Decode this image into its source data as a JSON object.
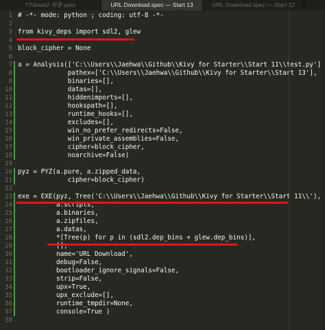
{
  "tabs": [
    {
      "label": "YTdown2 최종 spec",
      "active": false
    },
    {
      "label": "URL Download.spec — Start 13",
      "active": true
    },
    {
      "label": "URL Download.spec — Start 12",
      "active": false
    }
  ],
  "code_lines": [
    "# -*- mode: python ; coding: utf-8 -*-",
    "",
    "from kivy_deps import sdl2, glew",
    "",
    "block_cipher = None",
    "",
    "a = Analysis(['C:\\\\Users\\\\Jaehwa\\\\Github\\\\Kivy for Starter\\\\Start 11\\\\test.py'],",
    "             pathex=['C:\\\\Users\\\\Jaehwa\\\\Github\\\\Kivy for Starter\\\\Start 13'],",
    "             binaries=[],",
    "             datas=[],",
    "             hiddenimports=[],",
    "             hookspath=[],",
    "             runtime_hooks=[],",
    "             excludes=[],",
    "             win_no_prefer_redirects=False,",
    "             win_private_assemblies=False,",
    "             cipher=block_cipher,",
    "             noarchive=False)",
    "",
    "pyz = PYZ(a.pure, a.zipped_data,",
    "             cipher=block_cipher)",
    "",
    "exe = EXE(pyz, Tree('C:\\\\Users\\\\Jaehwa\\\\Github\\\\Kivy for Starter\\\\Start 11\\\\'),",
    "          a.scripts,",
    "          a.binaries,",
    "          a.zipfiles,",
    "          a.datas,",
    "          *[Tree(p) for p in (sdl2.dep_bins + glew.dep_bins)],",
    "          [],",
    "          name='URL Download',",
    "          debug=False,",
    "          bootloader_ignore_signals=False,",
    "          strip=False,",
    "          upx=True,",
    "          upx_exclude=[],",
    "          runtime_tmpdir=None,",
    "          console=True )",
    ""
  ],
  "line_numbers": [
    "1",
    "2",
    "3",
    "4",
    "5",
    "6",
    "7",
    "8",
    "9",
    "10",
    "11",
    "12",
    "13",
    "14",
    "15",
    "16",
    "17",
    "18",
    "19",
    "20",
    "21",
    "22",
    "23",
    "24",
    "25",
    "26",
    "27",
    "28",
    "29",
    "30",
    "31",
    "32",
    "33",
    "34",
    "35",
    "36",
    "37",
    "38"
  ],
  "colors": {
    "background": "#272822",
    "gutter_mark": "#3fa24b",
    "annotation_red": "#e8141c"
  }
}
